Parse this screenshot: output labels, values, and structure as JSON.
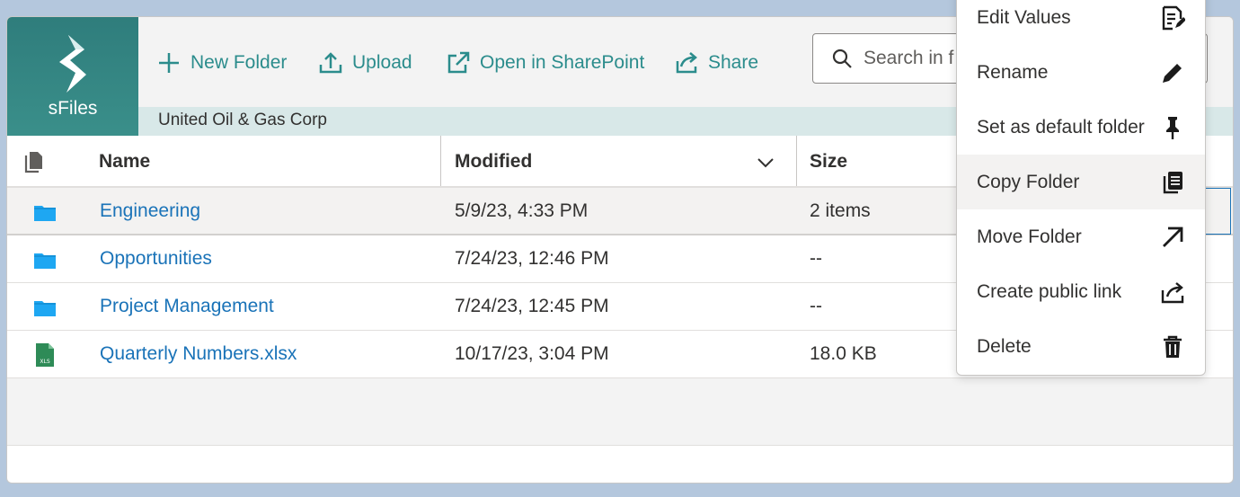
{
  "app": {
    "logo_text": "sFiles"
  },
  "toolbar": {
    "new_folder": "New Folder",
    "upload": "Upload",
    "open_sharepoint": "Open in SharePoint",
    "share": "Share"
  },
  "search": {
    "placeholder": "Search in f"
  },
  "breadcrumb": "United Oil & Gas Corp",
  "columns": {
    "name": "Name",
    "modified": "Modified",
    "size": "Size"
  },
  "files": [
    {
      "name": "Engineering",
      "modified": "5/9/23, 4:33 PM",
      "size": "2 items",
      "type": "folder"
    },
    {
      "name": "Opportunities",
      "modified": "7/24/23, 12:46 PM",
      "size": "--",
      "type": "folder"
    },
    {
      "name": "Project Management",
      "modified": "7/24/23, 12:45 PM",
      "size": "--",
      "type": "folder"
    },
    {
      "name": "Quarterly Numbers.xlsx",
      "modified": "10/17/23, 3:04 PM",
      "size": "18.0 KB",
      "type": "xlsx",
      "badge": "XLS"
    }
  ],
  "context_menu": {
    "items": [
      {
        "label": "Edit Values",
        "icon": "edit-values-icon"
      },
      {
        "label": "Rename",
        "icon": "pencil-icon"
      },
      {
        "label": "Set as default folder",
        "icon": "pin-icon"
      },
      {
        "label": "Copy Folder",
        "icon": "copy-icon"
      },
      {
        "label": "Move Folder",
        "icon": "arrow-up-right-icon"
      },
      {
        "label": "Create public link",
        "icon": "share-link-icon"
      },
      {
        "label": "Delete",
        "icon": "trash-icon"
      }
    ]
  },
  "colors": {
    "accent": "#2b8c8c",
    "link": "#1a73b8",
    "folder": "#1ea7f2",
    "excel": "#2e8b57"
  }
}
